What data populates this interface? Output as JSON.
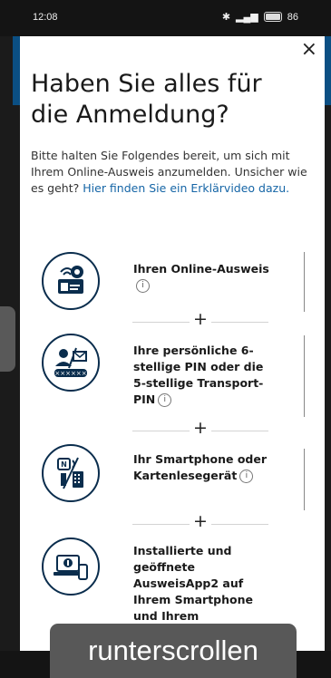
{
  "status_bar": {
    "time": "12:08",
    "battery": "86"
  },
  "dialog": {
    "close_label": "×",
    "title": "Haben Sie alles für die Anmeldung?",
    "intro_text": "Bitte halten Sie Folgendes bereit, um sich mit Ihrem Online-Ausweis anzumelden. Unsicher wie es geht?",
    "intro_link": "Hier finden Sie ein Erklärvideo dazu.",
    "info_glyph": "i",
    "plus": "+",
    "items": [
      {
        "label": "Ihren Online-Ausweis",
        "icon": "id-card-nfc-icon"
      },
      {
        "label": "Ihre persönliche 6-stellige PIN oder die 5-stellige Transport-PIN",
        "icon": "pin-letter-icon"
      },
      {
        "label": "Ihr Smartphone oder Kartenlesegerät",
        "icon": "smartphone-card-reader-icon"
      },
      {
        "label": "Installierte und geöffnete AusweisApp2 auf Ihrem Smartphone und Ihrem",
        "icon": "laptop-phone-icon"
      }
    ]
  },
  "overlay": {
    "caption": "runterscrollen"
  }
}
